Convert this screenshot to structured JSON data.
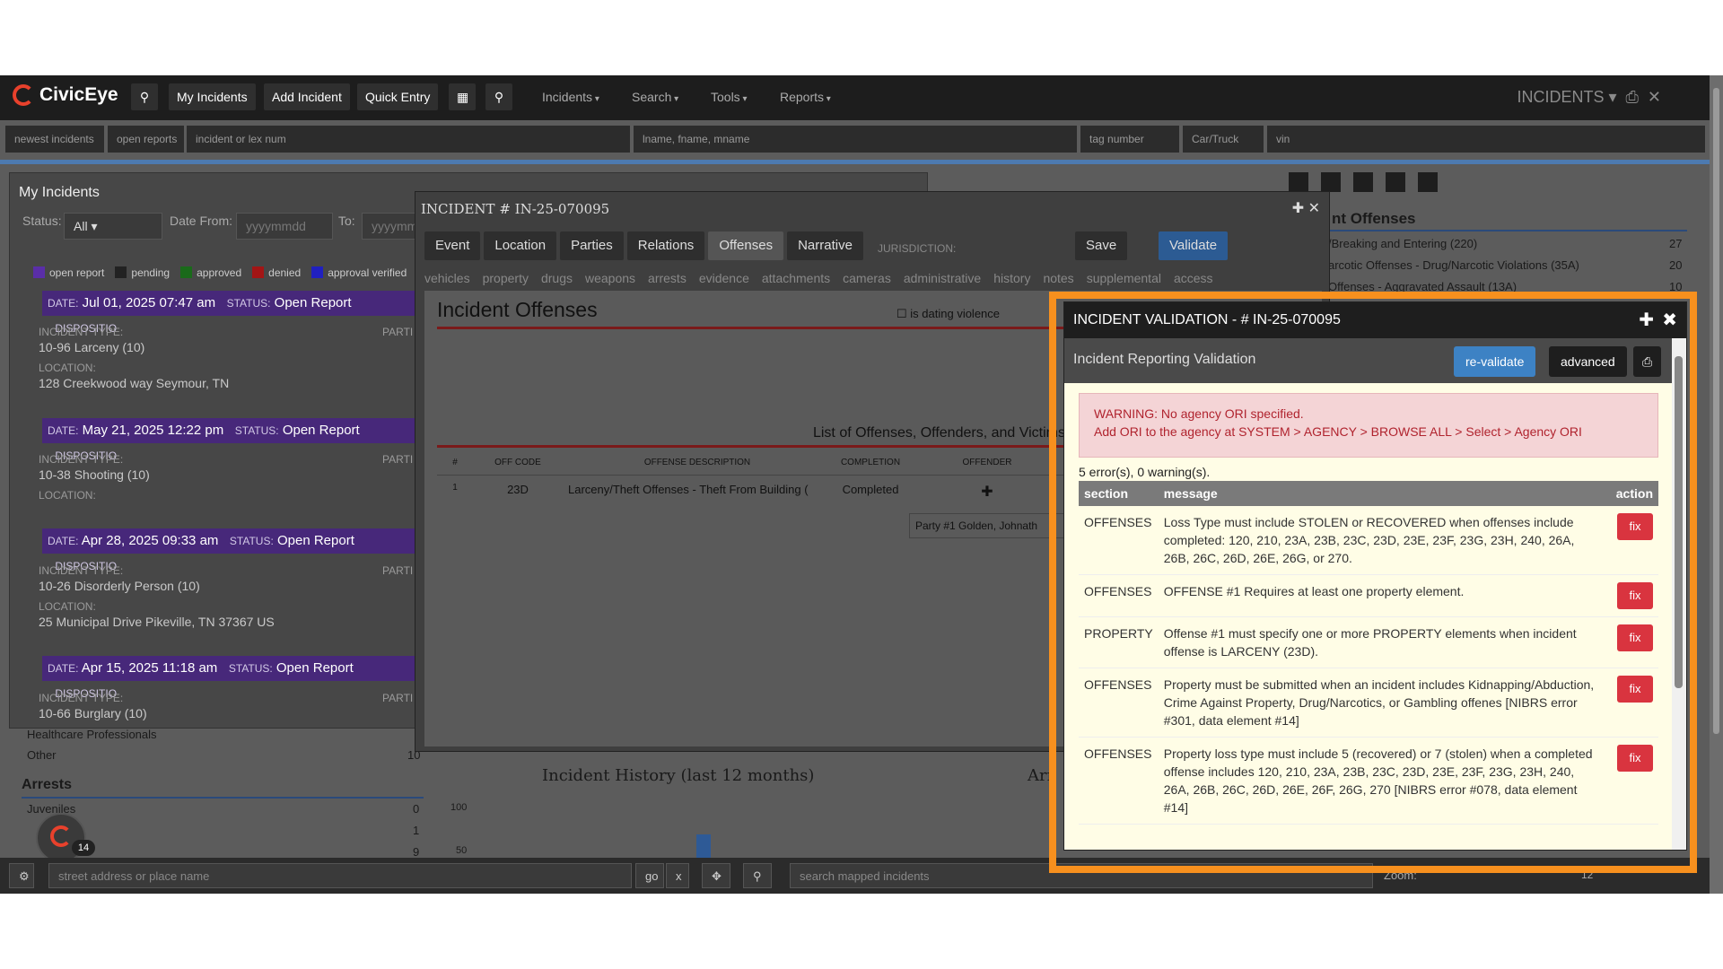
{
  "topbar": {
    "brand": "CivicEye",
    "my_incidents": "My Incidents",
    "add_incident": "Add Incident",
    "quick_entry": "Quick Entry",
    "menus": [
      "Incidents",
      "Search",
      "Tools",
      "Reports"
    ],
    "module": "INCIDENTS"
  },
  "searchbar": {
    "newest": "newest incidents",
    "open": "open reports",
    "incident_ph": "incident or lex num",
    "name_ph": "lname, fname, mname",
    "tag_ph": "tag number",
    "car_ph": "Car/Truck",
    "vin_ph": "vin"
  },
  "my_incidents": {
    "title": "My Incidents",
    "status_label": "Status:",
    "status_value": "All",
    "date_from_label": "Date From:",
    "date_ph": "yyyymmdd",
    "to_label": "To:",
    "legend": [
      "open report",
      "pending",
      "approved",
      "denied",
      "approval verified"
    ],
    "entries": [
      {
        "date": "Jul 01, 2025 07:47 am",
        "status": "Open Report",
        "type": "10-96 Larceny (10)",
        "location": "128 Creekwood way Seymour, TN"
      },
      {
        "date": "May 21, 2025 12:22 pm",
        "status": "Open Report",
        "type": "10-38 Shooting (10)",
        "location": ""
      },
      {
        "date": "Apr 28, 2025 09:33 am",
        "status": "Open Report",
        "type": "10-26 Disorderly Person (10)",
        "location": "25 Municipal Drive Pikeville, TN 37367 US"
      },
      {
        "date": "Apr 15, 2025 11:18 am",
        "status": "Open Report",
        "type": "10-66 Burglary (10)",
        "location": ""
      }
    ],
    "lbl_date": "DATE:",
    "lbl_status": "STATUS:",
    "lbl_type": "INCIDENT TYPE:",
    "lbl_location": "LOCATION:",
    "lbl_disp": "DISPOSITIO",
    "lbl_part": "PARTI"
  },
  "incident": {
    "title": "INCIDENT # IN-25-070095",
    "tabs": [
      "Event",
      "Location",
      "Parties",
      "Relations",
      "Offenses",
      "Narrative"
    ],
    "jurisdiction": "JURISDICTION:",
    "save": "Save",
    "validate": "Validate",
    "subtabs": [
      "vehicles",
      "property",
      "drugs",
      "weapons",
      "arrests",
      "evidence",
      "attachments",
      "cameras",
      "administrative",
      "history",
      "notes",
      "supplemental",
      "access"
    ],
    "section": "Incident Offenses",
    "dating": "is dating violence",
    "list_title": "List of Offenses, Offenders, and Victims",
    "cols": [
      "#",
      "OFF CODE",
      "OFFENSE DESCRIPTION",
      "COMPLETION",
      "OFFENDER"
    ],
    "row1": {
      "n": "1",
      "code": "23D",
      "desc": "Larceny/Theft Offenses - Theft From Building (",
      "completion": "Completed"
    },
    "party": "Party #1 Golden, Johnath"
  },
  "right_panel": {
    "title": "nt Offenses",
    "items": [
      {
        "t": "/Breaking and Entering (220)",
        "n": "27"
      },
      {
        "t": "arcotic Offenses - Drug/Narcotic Violations (35A)",
        "n": "20"
      },
      {
        "t": "Offenses - Aggravated Assault (13A)",
        "n": "10"
      }
    ]
  },
  "background": {
    "healthcare": "Healthcare Professionals",
    "other": "Other",
    "other_n": "10",
    "arrests": "Arrests",
    "juv": "Juveniles",
    "juv_n": "0",
    "te_n": "1",
    "adu_n": "9",
    "history": "Incident History (last 12 months)",
    "y100": "100",
    "y50": "50",
    "arr": "Arr",
    "badge": "14"
  },
  "bottom": {
    "address_ph": "street address or place name",
    "go": "go",
    "x": "x",
    "search_ph": "search mapped incidents",
    "zoom": "Zoom:",
    "zoom_v": "12"
  },
  "validation": {
    "title": "INCIDENT VALIDATION - # IN-25-070095",
    "subtitle": "Incident Reporting Validation",
    "revalidate": "re-validate",
    "advanced": "advanced",
    "warning1": "WARNING: No agency ORI specified.",
    "warning2": "Add ORI to the agency at SYSTEM > AGENCY > BROWSE ALL > Select > Agency ORI",
    "count": "5 error(s), 0 warning(s).",
    "col_section": "section",
    "col_message": "message",
    "col_action": "action",
    "fix": "fix",
    "rows": [
      {
        "section": "OFFENSES",
        "message": "Loss Type must include STOLEN or RECOVERED when offenses include completed: 120, 210, 23A, 23B, 23C, 23D, 23E, 23F, 23G, 23H, 240, 26A, 26B, 26C, 26D, 26E, 26G, or 270."
      },
      {
        "section": "OFFENSES",
        "message": "OFFENSE #1 Requires at least one property element."
      },
      {
        "section": "PROPERTY",
        "message": "Offense #1 must specify one or more PROPERTY elements when incident offense is LARCENY (23D)."
      },
      {
        "section": "OFFENSES",
        "message": "Property must be submitted when an incident includes Kidnapping/Abduction, Crime Against Property, Drug/Narcotics, or Gambling offenes [NIBRS error #301, data element #14]"
      },
      {
        "section": "OFFENSES",
        "message": "Property loss type must include 5 (recovered) or 7 (stolen) when a completed offense includes 120, 210, 23A, 23B, 23C, 23D, 23E, 23F, 23G, 23H, 240, 26A, 26B, 26C, 26D, 26E, 26F, 26G, 270 [NIBRS error #078, data element #14]"
      }
    ]
  }
}
